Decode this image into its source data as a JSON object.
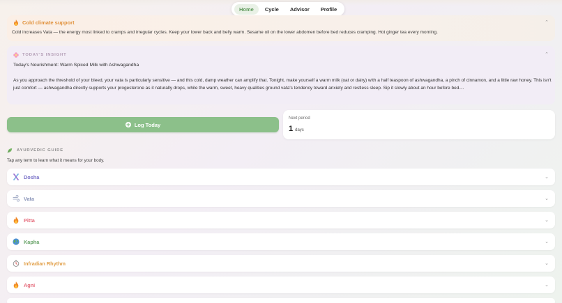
{
  "nav": {
    "tabs": [
      {
        "label": "Home",
        "active": true
      },
      {
        "label": "Cycle",
        "active": false
      },
      {
        "label": "Advisor",
        "active": false
      },
      {
        "label": "Profile",
        "active": false
      }
    ]
  },
  "cold_card": {
    "icon": "flame-icon",
    "title": "Cold climate support",
    "body": "Cold increases Vata — the energy most linked to cramps and irregular cycles. Keep your lower back and belly warm. Sesame oil on the lower abdomen before bed reduces cramping. Hot ginger tea every morning."
  },
  "insight": {
    "icon": "flower-icon",
    "heading": "TODAY'S INSIGHT",
    "title": "Today's Nourishment: Warm Spiced Milk with Ashwagandha",
    "body": "As you approach the threshold of your bleed, your vata is particularly sensitive — and this cold, damp weather can amplify that. Tonight, make yourself a warm milk (oat or dairy) with a half teaspoon of ashwagandha, a pinch of cinnamon, and a little raw honey. This isn't just comfort — ashwagandha directly supports your progesterone as it naturally drops, while the warm, sweet, heavy qualities ground vata's tendency toward anxiety and restless sleep. Sip it slowly about an hour before bed...."
  },
  "log_button": {
    "label": "Log Today",
    "icon": "plus-circle-icon"
  },
  "next_period": {
    "label": "Next period",
    "value": "1",
    "unit": "days"
  },
  "guide": {
    "icon": "leaf-icon",
    "heading": "AYURVEDIC GUIDE",
    "subtitle": "Tap any term to learn what it means for your body.",
    "items": [
      {
        "label": "Dosha",
        "icon": "dna-icon",
        "color": "#7a72c8"
      },
      {
        "label": "Vata",
        "icon": "wind-icon",
        "color": "#8a94b8"
      },
      {
        "label": "Pitta",
        "icon": "flame-icon",
        "color": "#e56b7b"
      },
      {
        "label": "Kapha",
        "icon": "globe-icon",
        "color": "#6aa56a"
      },
      {
        "label": "Infradian Rhythm",
        "icon": "stopwatch-icon",
        "color": "#e2a04a"
      },
      {
        "label": "Agni",
        "icon": "flame-icon",
        "color": "#e56b7b"
      }
    ]
  },
  "colors": {
    "accent_green": "#8cc08a",
    "cold_title": "#e0913b",
    "insight_bg": "#f2edf6"
  }
}
